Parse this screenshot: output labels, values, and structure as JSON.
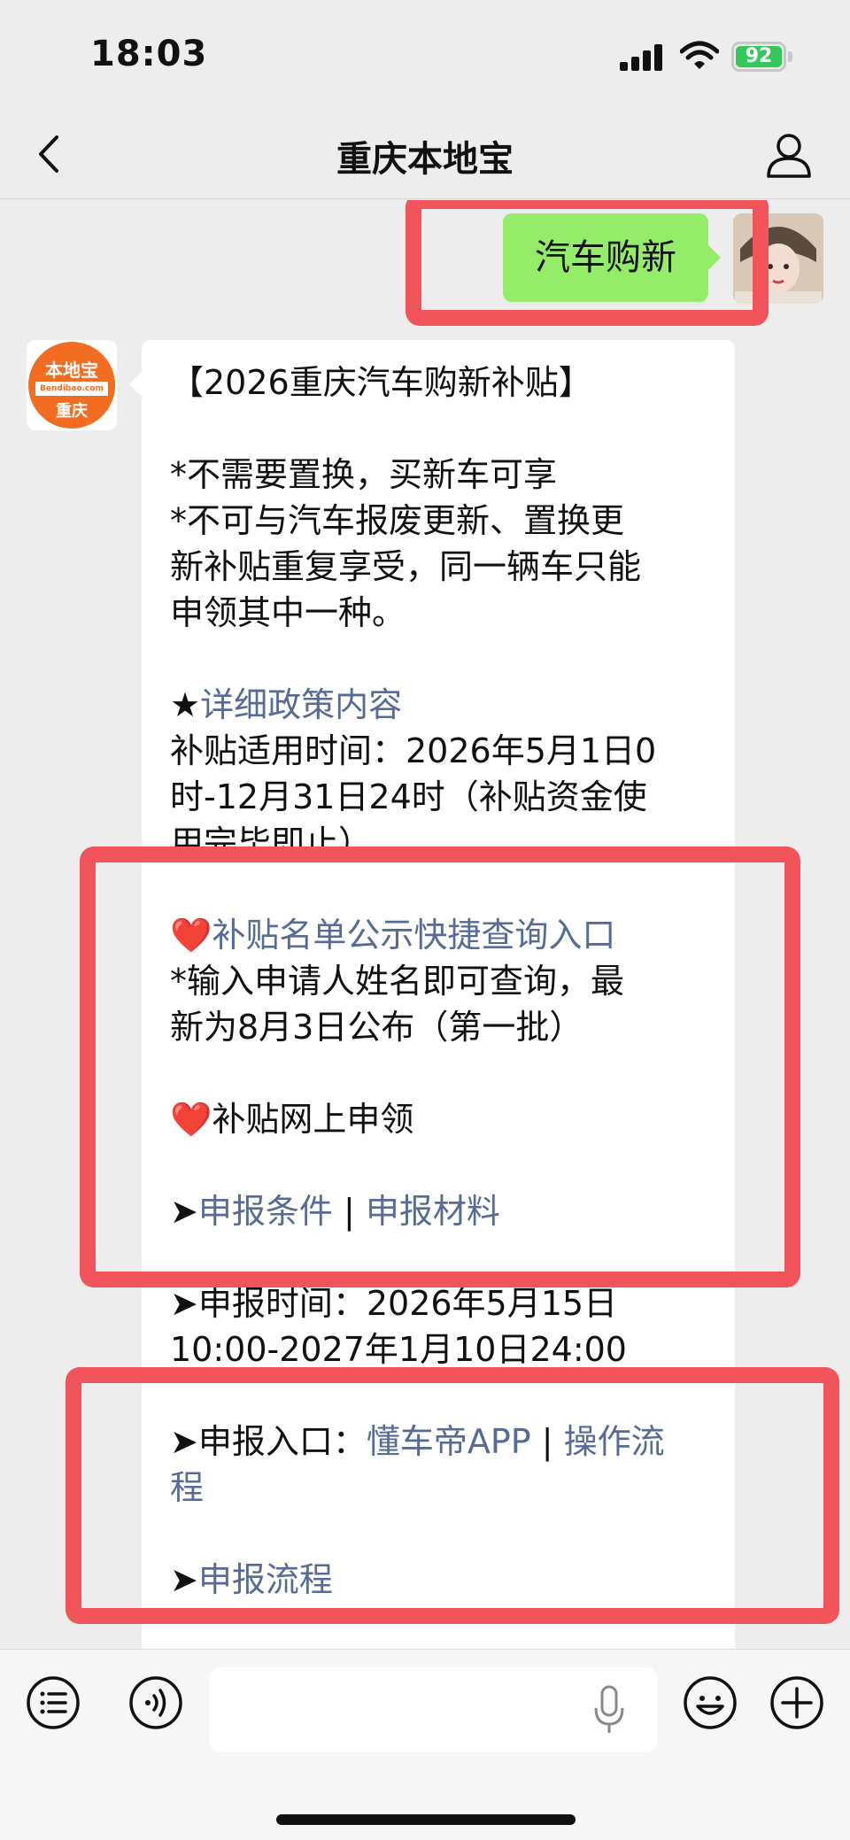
{
  "status_bar": {
    "time": "18:03",
    "battery": "92"
  },
  "nav": {
    "title": "重庆本地宝"
  },
  "sent_message": {
    "text": "汽车购新"
  },
  "bot": {
    "logo_top": "本地宝",
    "logo_url": "Bendibao.com",
    "logo_bottom": "重庆"
  },
  "message": {
    "line1": "【2026重庆汽车购新补贴】",
    "line2": "*不需要置换，买新车可享",
    "line3": "*不可与汽车报废更新、置换更",
    "line4": "新补贴重复享受，同一辆车只能",
    "line5": "申领其中一种。",
    "star": "★",
    "policy_link": "详细政策内容",
    "line7": "补贴适用时间：2026年5月1日0",
    "line8": "时-12月31日24时（补贴资金使",
    "line9": "用完毕即止）",
    "heart": "❤️",
    "query_link": "补贴名单公示快捷查询入口",
    "line11": "*输入申请人姓名即可查询，最",
    "line12": "新为8月3日公布（第一批）",
    "online_apply": "补贴网上申领",
    "arrow": "➤",
    "conditions_link": "申报条件",
    "separator": " | ",
    "materials_link": "申报材料",
    "line16": "申报时间：2026年5月15日",
    "line17": "10:00-2027年1月10日24:00",
    "entry_label": "申报入口：",
    "app_link": "懂车帝APP",
    "operation_link_a": "操作流",
    "operation_link_b": "程",
    "process_link": "申报流程"
  },
  "colors": {
    "background": "#ededed",
    "sent_bubble": "#95ec69",
    "link": "#576b95",
    "highlight": "#f2545b",
    "battery": "#34c759"
  }
}
